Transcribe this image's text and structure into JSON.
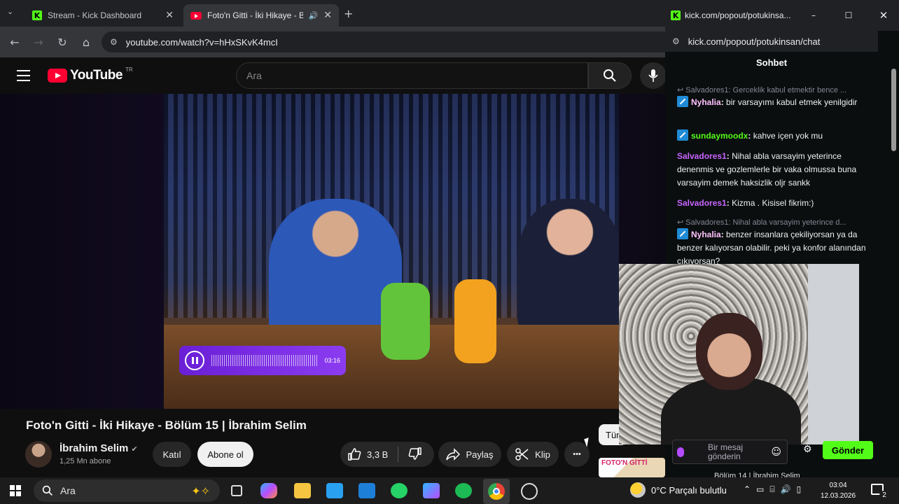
{
  "browser_left": {
    "tabs": [
      {
        "title": "Stream - Kick Dashboard",
        "favicon": "kick-icon"
      },
      {
        "title": "Foto'n Gitti - İki Hikaye - Bö",
        "favicon": "youtube-icon",
        "active": true
      }
    ],
    "url": "youtube.com/watch?v=hHxSKvK4mcI"
  },
  "youtube": {
    "logo_text": "YouTube",
    "logo_region": "TR",
    "search_placeholder": "Ara",
    "video_title": "Foto'n Gitti - İki Hikaye - Bölüm 15 | İbrahim Selim",
    "channel_name": "İbrahim Selim",
    "subscribers": "1,25 Mn abone",
    "join_label": "Katıl",
    "subscribe_label": "Abone ol",
    "likes": "3,3 B",
    "share_label": "Paylaş",
    "clip_label": "Klip",
    "more_label": "•••",
    "chip_partial": "Tüm",
    "next_thumb_text": "FOTO'N GİTTİ",
    "next_title_partial": "Bölüm 14 | İbrahim Selim"
  },
  "audio_player": {
    "time": "03:16"
  },
  "popout": {
    "window_title": "kick.com/popout/potukinsa...",
    "url": "kick.com/popout/potukinsan/chat",
    "chat_header": "Sohbet",
    "messages": [
      {
        "type": "reply",
        "text": "Salvadores1: Gerceklik kabul etmektir bence ..."
      },
      {
        "user": "Nyhalia",
        "color": "#ffc2ff",
        "badge": true,
        "text": "bir varsayımı kabul etmek yenilgidir"
      },
      {
        "user": "sundaymoodx",
        "color": "#53fc18",
        "badge": true,
        "text": "kahve içen yok mu"
      },
      {
        "user": "Salvadores1",
        "color": "#c865ff",
        "badge": false,
        "text": "Nihal abla varsayim yeterince denenmis ve gozlemlerle bir vaka olmussa buna varsayim demek haksizlik oljr sankk"
      },
      {
        "user": "Salvadores1",
        "color": "#c865ff",
        "badge": false,
        "text": "Kizma . Kisisel fikrim:)"
      },
      {
        "type": "reply",
        "text": "Salvadores1: Nihal abla varsayim yeterince d..."
      },
      {
        "user": "Nyhalia",
        "color": "#ffc2ff",
        "badge": true,
        "text": "benzer insanlara çekiliyorsan ya da benzer kalıyorsan olabilir. peki ya konfor alanından çıkıyorsan?"
      }
    ],
    "input_placeholder_line1": "Bir mesaj",
    "input_placeholder_line2": "gönderin",
    "send_label": "Gönder"
  },
  "taskbar": {
    "search_placeholder": "Ara",
    "weather_temp": "0°C",
    "weather_text": "Parçalı bulutlu",
    "time": "03:04",
    "date": "12.03.2026",
    "notification_count": "2"
  },
  "colors": {
    "kick_green": "#53fc18",
    "youtube_red": "#ff0033",
    "audio_purple": "#7a2ee6"
  }
}
